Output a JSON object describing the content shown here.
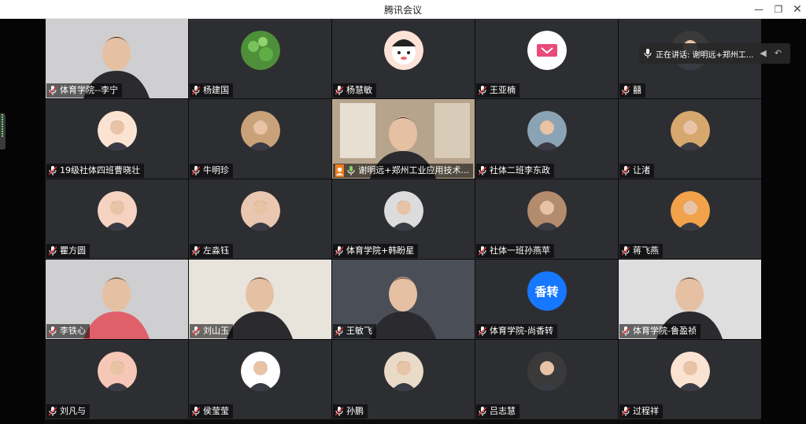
{
  "window": {
    "title": "腾讯会议",
    "minimize_icon": "minimize-icon",
    "restore_icon": "restore-icon",
    "close_icon": "close-icon"
  },
  "speaking_tip": {
    "label": "正在讲话: 谢明远+郑州工..."
  },
  "colors": {
    "tile_bg": "#2d2e32",
    "speaking_border": "#7fd46b",
    "host_badge": "#f07d1b",
    "text_avatar": "#1677ff"
  },
  "participants": [
    {
      "name": "体育学院--李宁",
      "kind": "video"
    },
    {
      "name": "杨建国",
      "kind": "avatar"
    },
    {
      "name": "杨慧敏",
      "kind": "avatar"
    },
    {
      "name": "王亚楠",
      "kind": "avatar"
    },
    {
      "name": "囍",
      "kind": "avatar"
    },
    {
      "name": "19级社体四班曹晓壮",
      "kind": "avatar"
    },
    {
      "name": "牛明珍",
      "kind": "avatar"
    },
    {
      "name": "谢明远+郑州工业应用技术...",
      "kind": "video",
      "host": true,
      "speaking": true
    },
    {
      "name": "社体二班李东政",
      "kind": "avatar"
    },
    {
      "name": "让渚",
      "kind": "avatar"
    },
    {
      "name": "瞿方圆",
      "kind": "avatar"
    },
    {
      "name": "左淼钰",
      "kind": "avatar"
    },
    {
      "name": "体育学院+韩盼星",
      "kind": "avatar"
    },
    {
      "name": "社体一班孙燕苹",
      "kind": "avatar"
    },
    {
      "name": "蒋飞燕",
      "kind": "avatar"
    },
    {
      "name": "李铁心",
      "kind": "video"
    },
    {
      "name": "刘山玉",
      "kind": "video"
    },
    {
      "name": "王敏飞",
      "kind": "video"
    },
    {
      "name": "体育学院-尚香转",
      "kind": "text",
      "avatar_text": "香转"
    },
    {
      "name": "体育学院-鲁盈祯",
      "kind": "video"
    },
    {
      "name": "刘凡与",
      "kind": "avatar"
    },
    {
      "name": "侯莹莹",
      "kind": "avatar"
    },
    {
      "name": "孙鹏",
      "kind": "avatar"
    },
    {
      "name": "吕志慧",
      "kind": "avatar"
    },
    {
      "name": "过程祥",
      "kind": "avatar"
    }
  ]
}
